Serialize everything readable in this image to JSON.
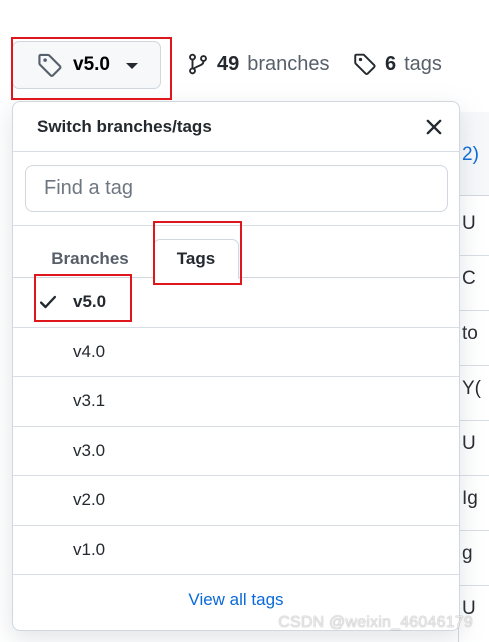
{
  "ref_button": {
    "label": "v5.0",
    "icon": "tag-icon"
  },
  "repo_meta": {
    "branches_count": "49",
    "branches_label": "branches",
    "branches_icon": "git-branch-icon",
    "tags_count": "6",
    "tags_label": "tags",
    "tags_icon": "tag-icon"
  },
  "dropdown": {
    "title": "Switch branches/tags",
    "filter_placeholder": "Find a tag",
    "filter_value": "",
    "tabs": [
      {
        "label": "Branches",
        "selected": false
      },
      {
        "label": "Tags",
        "selected": true
      }
    ],
    "items": [
      {
        "label": "v5.0",
        "selected": true
      },
      {
        "label": "v4.0",
        "selected": false
      },
      {
        "label": "v3.1",
        "selected": false
      },
      {
        "label": "v3.0",
        "selected": false
      },
      {
        "label": "v2.0",
        "selected": false
      },
      {
        "label": "v1.0",
        "selected": false
      }
    ],
    "footer_link": "View all tags"
  },
  "background_fragments": [
    "2)",
    "U",
    "C",
    "to",
    "Y(",
    "U",
    "Ig",
    "g",
    "U"
  ],
  "watermark": "CSDN @weixin_46046179",
  "colors": {
    "link": "#0969da",
    "annotation": "#e0161d",
    "muted": "#57606a",
    "text": "#24292f"
  }
}
